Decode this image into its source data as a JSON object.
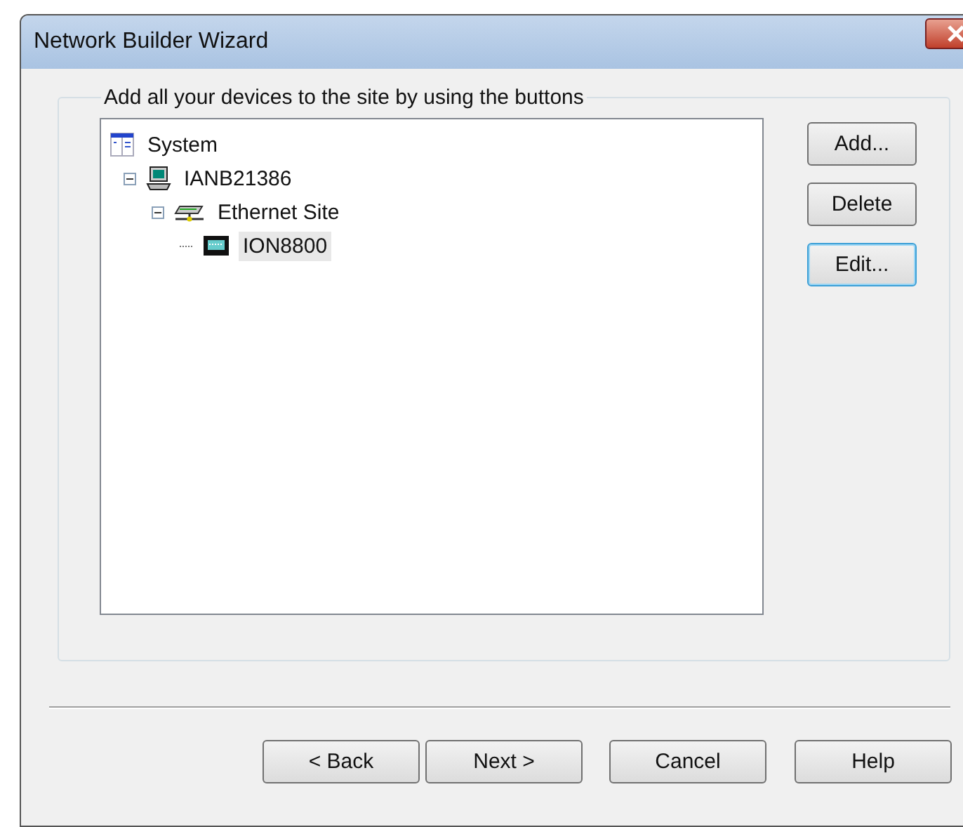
{
  "window": {
    "title": "Network Builder Wizard"
  },
  "group": {
    "label": "Add all your devices to the site by using the buttons"
  },
  "tree": [
    {
      "label": "System",
      "kind": "system",
      "selected": false,
      "children": [
        {
          "label": "IANB21386",
          "kind": "computer",
          "expanded": true,
          "selected": false,
          "children": [
            {
              "label": "Ethernet Site",
              "kind": "network",
              "expanded": true,
              "selected": false,
              "children": [
                {
                  "label": "ION8800",
                  "kind": "device",
                  "selected": true
                }
              ]
            }
          ]
        }
      ]
    }
  ],
  "side_buttons": [
    {
      "label": "Add...",
      "focused": false
    },
    {
      "label": "Delete",
      "focused": false
    },
    {
      "label": "Edit...",
      "focused": true
    }
  ],
  "footer_buttons": [
    {
      "label": "< Back"
    },
    {
      "label": "Next >"
    },
    {
      "label": "Cancel"
    },
    {
      "label": "Help"
    }
  ]
}
